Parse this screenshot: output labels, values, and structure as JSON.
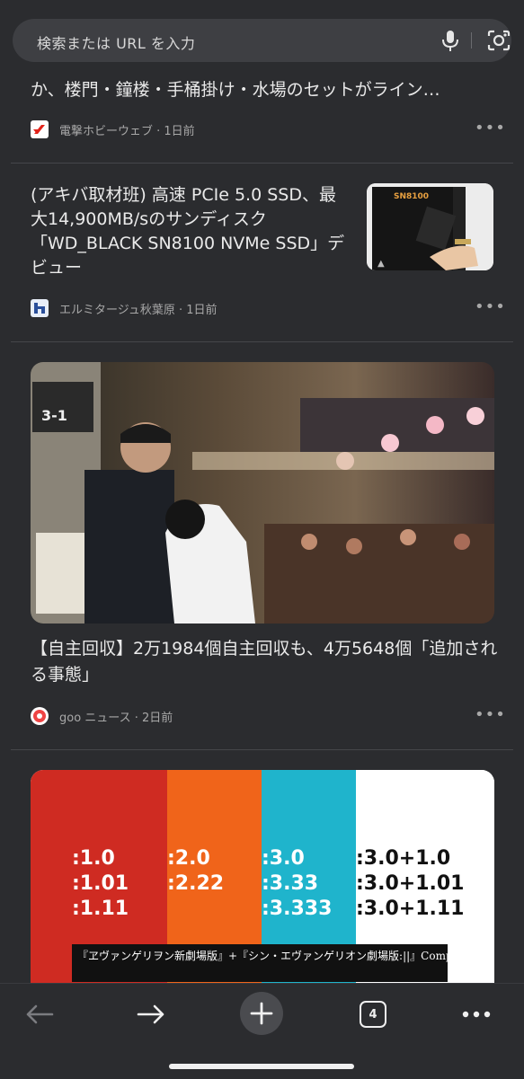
{
  "search": {
    "placeholder": "検索または URL を入力"
  },
  "feed": [
    {
      "title": "か、楼門・鐘楼・手桶掛け・水場のセットがライン…",
      "source": "電撃ホビーウェブ · 1日前"
    },
    {
      "title": "(アキバ取材班) 高速 PCIe 5.0 SSD、最大14,900MB/sのサンディスク「WD_BLACK SN8100 NVMe SSD」デビュー",
      "source": "エルミタージュ秋葉原 · 1日前",
      "thumb_text": "SN8100"
    },
    {
      "title": "【自主回収】2万1984個自主回収も、4万5648個「追加される事態」",
      "source": "goo ニュース · 2日前",
      "image_sign": "3-1"
    },
    {
      "image_columns": [
        {
          "lines": [
            ":1.0",
            ":1.01",
            ":1.11"
          ],
          "color": "#cf2b22",
          "text_color": "#ffffff"
        },
        {
          "lines": [
            ":2.0",
            ":2.22"
          ],
          "color": "#f0641a",
          "text_color": "#ffffff"
        },
        {
          "lines": [
            ":3.0",
            ":3.33",
            ":3.333"
          ],
          "color": "#1fb4cc",
          "text_color": "#ffffff"
        },
        {
          "lines": [
            ":3.0+1.0",
            ":3.0+1.01",
            ":3.0+1.11"
          ],
          "color": "#ffffff",
          "text_color": "#111111"
        }
      ],
      "banner": "『ヱヴァンゲリヲン新劇場版』+『シン・エヴァンゲリオン劇場版:||』Complete Blu-ray BOX"
    }
  ],
  "toolbar": {
    "tab_count": "4"
  },
  "colors": {
    "background": "#2b2c2f",
    "search_bg": "#3e3f43",
    "text": "#eaeaea",
    "muted": "#a8a8a8"
  }
}
